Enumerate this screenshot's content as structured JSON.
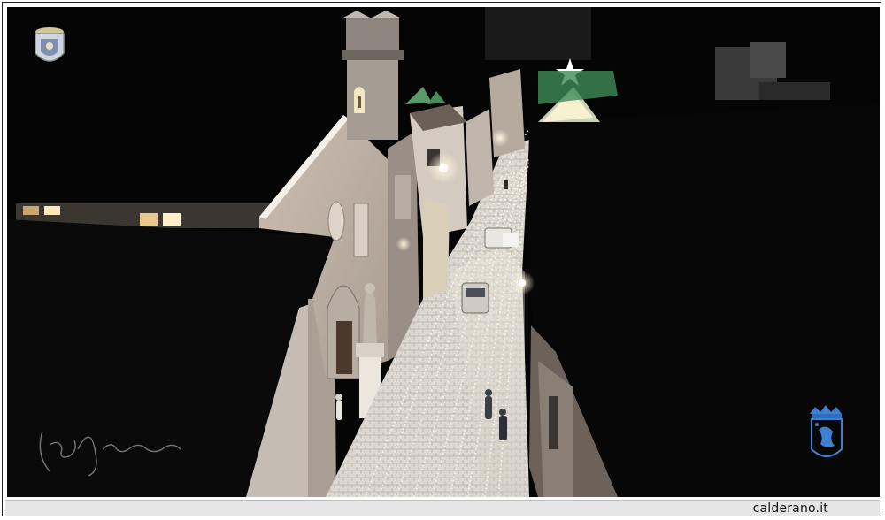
{
  "photo": {
    "subject": "night-aerial-street-with-christmas-lights",
    "colors": {
      "sky": "#050505",
      "facade": "#c7b9ad",
      "facade_shadow": "#8e847c",
      "street": "#d8d4cf",
      "lights": "#fff4d6",
      "tree_green": "#4a8a5a",
      "crest_blue": "#3d7fd1"
    }
  },
  "overlays": {
    "top_left_logo": "coat-of-arms-icon",
    "bottom_right_crest": "crown-crest-icon",
    "signature": "handwritten-signature"
  },
  "caption": {
    "site": "calderano.it"
  }
}
